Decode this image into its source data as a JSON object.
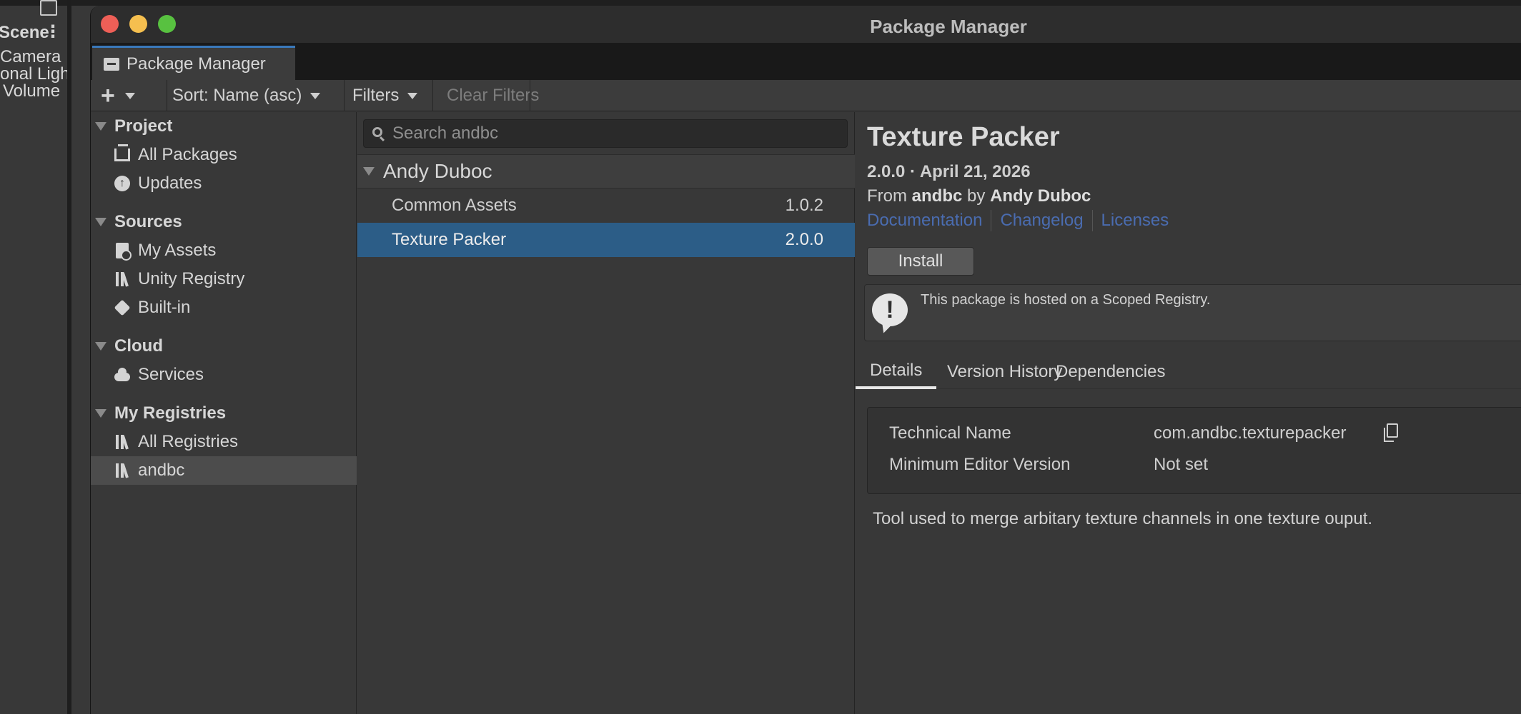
{
  "background": {
    "hierarchy_items": [
      "Scene",
      "Camera",
      "onal Ligh",
      "Volume"
    ]
  },
  "window": {
    "title": "Package Manager",
    "tab_label": "Package Manager"
  },
  "toolbar": {
    "add_label": "+",
    "sort_label": "Sort: Name (asc)",
    "filters_label": "Filters",
    "clear_filters_label": "Clear Filters"
  },
  "sidebar": {
    "project_header": "Project",
    "project_items": [
      {
        "label": "All Packages",
        "icon": "package-tray-icon"
      },
      {
        "label": "Updates",
        "icon": "arrow-up-circle-icon"
      }
    ],
    "sources_header": "Sources",
    "sources_items": [
      {
        "label": "My Assets",
        "icon": "document-icon"
      },
      {
        "label": "Unity Registry",
        "icon": "library-icon"
      },
      {
        "label": "Built-in",
        "icon": "unity-cube-icon"
      }
    ],
    "cloud_header": "Cloud",
    "cloud_items": [
      {
        "label": "Services",
        "icon": "cloud-icon"
      }
    ],
    "registries_header": "My Registries",
    "registries_items": [
      {
        "label": "All Registries",
        "icon": "library-icon"
      },
      {
        "label": "andbc",
        "icon": "library-icon",
        "selected": true
      }
    ]
  },
  "package_list": {
    "search_placeholder": "Search andbc",
    "group_label": "Andy Duboc",
    "packages": [
      {
        "name": "Common Assets",
        "version": "1.0.2",
        "selected": false
      },
      {
        "name": "Texture Packer",
        "version": "2.0.0",
        "selected": true
      }
    ]
  },
  "details": {
    "title": "Texture Packer",
    "version_line": "2.0.0 · April 21, 2026",
    "from_prefix": "From",
    "from_registry": "andbc",
    "by_word": "by",
    "author": "Andy Duboc",
    "links": [
      "Documentation",
      "Changelog",
      "Licenses"
    ],
    "install_label": "Install",
    "notice_text": "This package is hosted on a Scoped Registry.",
    "tabs": [
      "Details",
      "Version History",
      "Dependencies"
    ],
    "active_tab": "Details",
    "technical_name_key": "Technical Name",
    "technical_name_value": "com.andbc.texturepacker",
    "min_editor_key": "Minimum Editor Version",
    "min_editor_value": "Not set",
    "description": "Tool used to merge arbitary texture channels in one texture ouput."
  },
  "colors": {
    "selection": "#2c5d87",
    "link": "#4a6cb0",
    "tab_accent": "#3a79bb"
  }
}
